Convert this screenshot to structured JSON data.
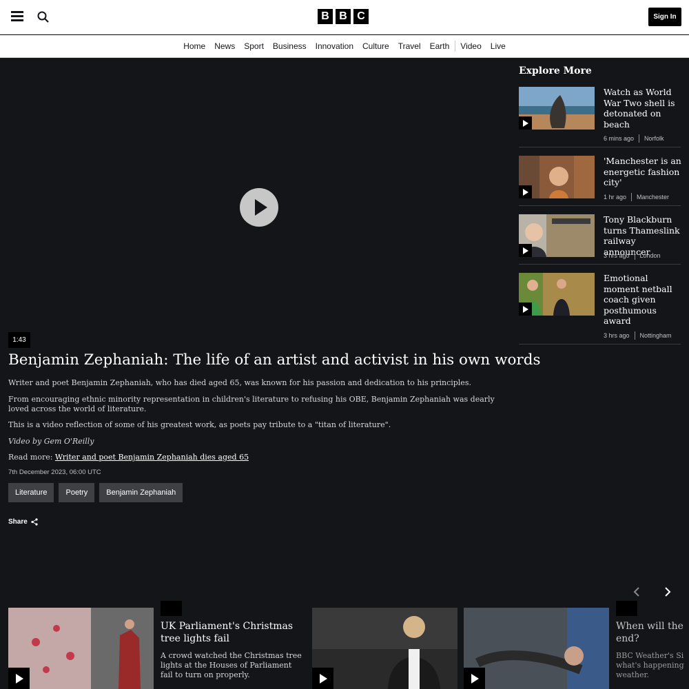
{
  "header": {
    "logo_letters": [
      "B",
      "B",
      "C"
    ],
    "signin_label": "Sign In",
    "menu_icon": "hamburger-menu-icon",
    "search_icon": "search-icon"
  },
  "nav": {
    "items": [
      "Home",
      "News",
      "Sport",
      "Business",
      "Innovation",
      "Culture",
      "Travel",
      "Earth",
      "Video",
      "Live"
    ]
  },
  "video": {
    "duration": "1:43",
    "title": "Benjamin Zephaniah: The life of an artist and activist in his own words",
    "paragraphs": [
      "Writer and poet Benjamin Zephaniah, who has died aged 65, was known for his passion and dedication to his principles.",
      "From encouraging ethnic minority representation in children's literature to refusing his OBE, Benjamin Zephaniah was dearly loved across the world of literature.",
      "This is a video reflection of some of his greatest work, as poets pay tribute to a \"titan of literature\"."
    ],
    "credit": "Video by Gem O'Reilly",
    "read_more_prefix": "Read more:",
    "read_more_link": "Writer and poet Benjamin Zephaniah dies aged 65",
    "date": "7th December 2023, 06:00 UTC",
    "tags": [
      "Literature",
      "Poetry",
      "Benjamin Zephaniah"
    ],
    "share_label": "Share"
  },
  "explore": {
    "title": "Explore More",
    "cards": [
      {
        "title": "Watch as World War Two shell is detonated on beach",
        "time": "6 mins ago",
        "location": "Norfolk"
      },
      {
        "title": "'Manchester is an energetic fashion city'",
        "time": "1 hr ago",
        "location": "Manchester"
      },
      {
        "title": "Tony Blackburn turns Thameslink railway announcer",
        "time": "3 hrs ago",
        "location": "London"
      },
      {
        "title": "Emotional moment netball coach given posthumous award",
        "time": "3 hrs ago",
        "location": "Nottingham"
      }
    ]
  },
  "carousel": {
    "items": [
      {
        "title": "UK Parliament's Christmas tree lights fail",
        "desc": "A crowd watched the Christmas tree lights at the Houses of Parliament fail to turn on properly."
      },
      {
        "title": "When will the end?",
        "desc": "BBC Weather's Si what's happening weather."
      }
    ]
  }
}
